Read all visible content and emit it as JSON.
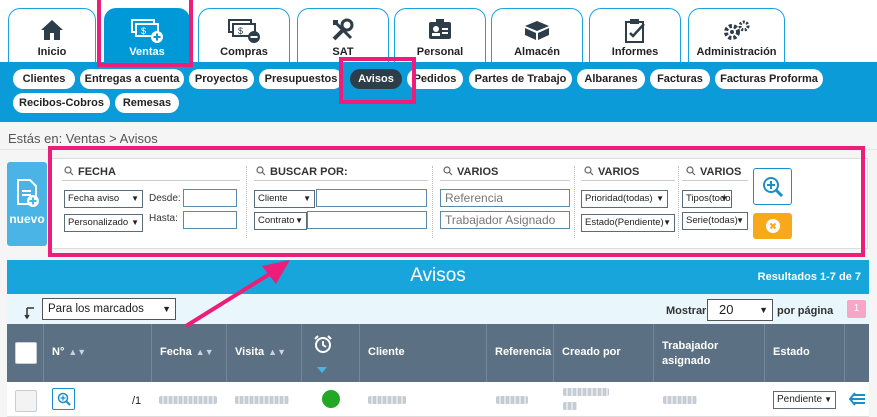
{
  "modules": [
    {
      "label": "Inicio",
      "icon": "home-icon"
    },
    {
      "label": "Ventas",
      "icon": "cash-plus-icon"
    },
    {
      "label": "Compras",
      "icon": "cash-minus-icon"
    },
    {
      "label": "SAT",
      "icon": "tools-icon"
    },
    {
      "label": "Personal",
      "icon": "id-card-icon"
    },
    {
      "label": "Almacén",
      "icon": "boxes-icon"
    },
    {
      "label": "Informes",
      "icon": "clipboard-check-icon"
    },
    {
      "label": "Administración",
      "icon": "gears-icon"
    }
  ],
  "submenu": [
    "Clientes",
    "Entregas a cuenta",
    "Proyectos",
    "Presupuestos",
    "Avisos",
    "Pedidos",
    "Partes de Trabajo",
    "Albaranes",
    "Facturas",
    "Facturas Proforma",
    "Recibos-Cobros",
    "Remesas"
  ],
  "breadcrumb": "Estás en: Ventas > Avisos",
  "new_button": "nuevo",
  "filters": {
    "fecha": {
      "title": "FECHA",
      "date_field": "Fecha aviso",
      "range": "Personalizado",
      "from_label": "Desde:",
      "to_label": "Hasta:"
    },
    "buscar": {
      "title": "BUSCAR POR:",
      "field1": "Cliente",
      "field2": "Contrato"
    },
    "varios1": {
      "title": "VARIOS",
      "ph1": "Referencia",
      "ph2": "Trabajador Asignado"
    },
    "varios2": {
      "title": "VARIOS",
      "sel1": "Prioridad(todas)",
      "sel2": "Estado(Pendiente)"
    },
    "varios3": {
      "title": "VARIOS",
      "sel1": "Tipos(todos)",
      "sel2": "Serie(todas)"
    }
  },
  "results": {
    "title": "Avisos",
    "count": "Resultados 1-7 de 7",
    "bulk_action": "Para los marcados",
    "show_label": "Mostrar",
    "per_page": "20",
    "per_page_label": "por página",
    "page": "1"
  },
  "table": {
    "headers": [
      "N°",
      "Fecha",
      "Visita",
      "Cliente",
      "Referencia",
      "Creado por",
      "Trabajador asignado",
      "Estado"
    ],
    "row": {
      "number": "/1",
      "status": "Pendiente",
      "status_color": "#22a825"
    }
  },
  "colors": {
    "primary": "#0a9bd8",
    "highlight": "#ec1e79",
    "header_dark": "#5b7083",
    "warning": "#f7a81b"
  }
}
